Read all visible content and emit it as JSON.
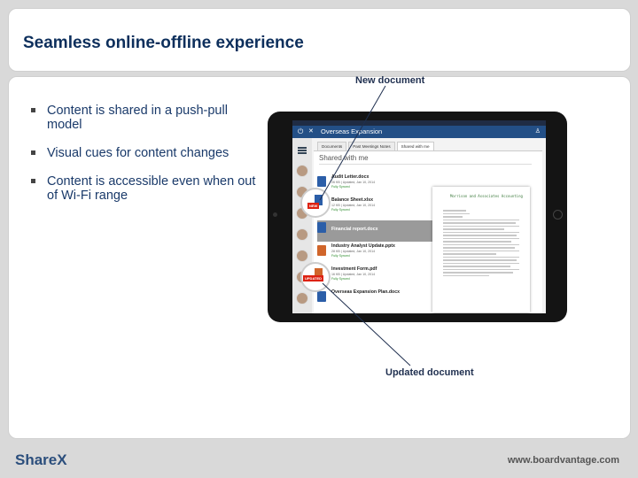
{
  "header": {
    "title": "Seamless online-offline experience"
  },
  "bullets": [
    "Content is shared in a push-pull model",
    "Visual cues for content changes",
    "Content is accessible even when out of Wi-Fi range"
  ],
  "callouts": {
    "new_document": "New document",
    "updated_document": "Updated document"
  },
  "app": {
    "title": "Overseas Expansion",
    "tabs": [
      "Documents",
      "Past Meetings Notes",
      "Shared with me"
    ],
    "section_title": "Shared with me",
    "documents": [
      {
        "name": "Audit Letter.docx",
        "meta": "26 KB | Updated, Jan 10, 2014",
        "sync": "Fully Synced",
        "icon": "word-icon"
      },
      {
        "name": "Balance Sheet.xlsx",
        "meta": "12 KB | Updated, Jan 10, 2014",
        "sync": "Fully Synced",
        "icon": "excel-icon"
      },
      {
        "name": "Financial report.docx",
        "meta": "",
        "sync": "",
        "icon": "word-icon"
      },
      {
        "name": "Industry Analyst Update.pptx",
        "meta": "28 KB | Updated, Jan 10, 2014",
        "sync": "Fully Synced",
        "icon": "powerpoint-icon"
      },
      {
        "name": "Investment Form.pdf",
        "meta": "16 KB | Updated, Jan 10, 2014",
        "sync": "Fully Synced",
        "icon": "pdf-icon"
      },
      {
        "name": "Overseas Expansion Plan.docx",
        "meta": "",
        "sync": "",
        "icon": "word-icon"
      }
    ],
    "preview_title": "Morrison and Associates Accounting",
    "badge_new": "NEW",
    "badge_updated": "UPDATED"
  },
  "footer": {
    "brand": "ShareX",
    "url": "www.boardvantage.com"
  },
  "colors": {
    "title": "#0d2f5c",
    "bullet_text": "#1a3a6a",
    "app_bar": "#234f86",
    "badge_red": "#d21"
  }
}
